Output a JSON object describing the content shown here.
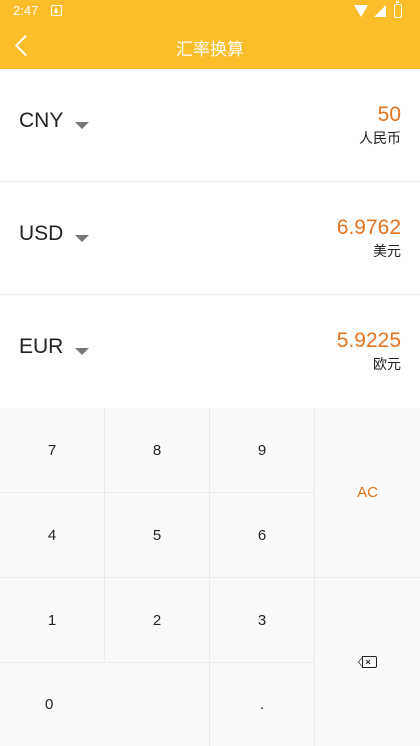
{
  "status_bar": {
    "time": "2:47"
  },
  "app_bar": {
    "title": "汇率换算"
  },
  "currencies": [
    {
      "code": "CNY",
      "value": "50",
      "name": "人民币"
    },
    {
      "code": "USD",
      "value": "6.9762",
      "name": "美元"
    },
    {
      "code": "EUR",
      "value": "5.9225",
      "name": "欧元"
    }
  ],
  "keypad": {
    "k7": "7",
    "k8": "8",
    "k9": "9",
    "k4": "4",
    "k5": "5",
    "k6": "6",
    "k1": "1",
    "k2": "2",
    "k3": "3",
    "k0": "0",
    "dot": ".",
    "ac": "AC",
    "backspace_icon": "backspace-icon"
  },
  "colors": {
    "accent": "#fbbd2a",
    "value": "#e2731f"
  }
}
